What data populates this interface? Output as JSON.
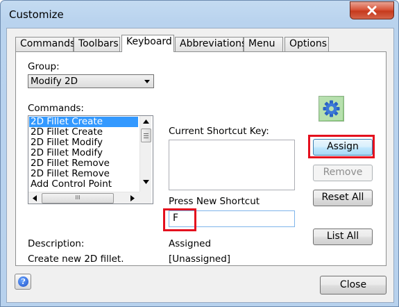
{
  "window": {
    "title": "Customize"
  },
  "tabs": [
    {
      "label": "Commands",
      "active": false
    },
    {
      "label": "Toolbars",
      "active": false
    },
    {
      "label": "Keyboard",
      "active": true
    },
    {
      "label": "Abbreviations",
      "active": false
    },
    {
      "label": "Menu",
      "active": false
    },
    {
      "label": "Options",
      "active": false
    }
  ],
  "keyboard": {
    "group_label": "Group:",
    "group_value": "Modify 2D",
    "commands_label": "Commands:",
    "commands": [
      "2D Fillet Create",
      "2D Fillet Create",
      "2D Fillet Modify",
      "2D Fillet Modify",
      "2D Fillet Remove",
      "2D Fillet Remove",
      "Add Control Point"
    ],
    "selected_command_index": 0,
    "hscroll_thumb_text": "III",
    "current_shortcut_label": "Current Shortcut Key:",
    "press_new_label": "Press New Shortcut",
    "new_shortcut_value": "F",
    "description_label": "Description:",
    "description_value": "Create new 2D fillet.",
    "assigned_label": "Assigned",
    "assigned_value": "[Unassigned]"
  },
  "buttons": {
    "assign": "Assign",
    "remove": "Remove",
    "reset_all": "Reset All",
    "list_all": "List All",
    "close": "Close"
  },
  "icons": {
    "title_close": "close-x-icon",
    "command_icon": "gear-icon",
    "help": "help-icon"
  },
  "colors": {
    "highlight_red": "#e4101e",
    "selection_blue": "#3399ff",
    "title_close_red": "#c63a1c"
  }
}
